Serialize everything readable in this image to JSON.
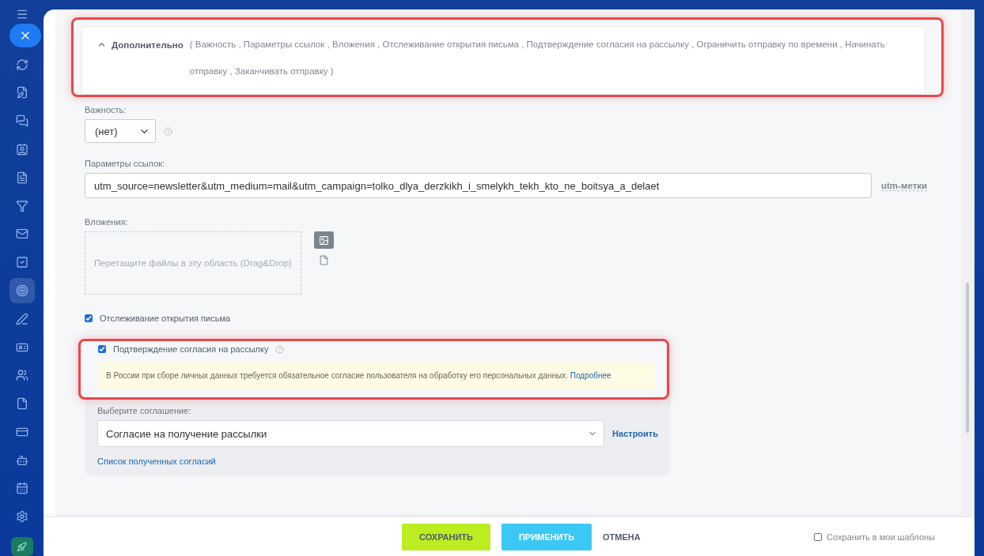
{
  "sidebar": {
    "items": [
      {
        "selected": false
      },
      {
        "selected": false
      },
      {
        "selected": false
      },
      {
        "selected": false
      },
      {
        "selected": false
      },
      {
        "selected": false
      },
      {
        "selected": false
      },
      {
        "selected": false
      },
      {
        "selected": true
      },
      {
        "selected": false
      },
      {
        "selected": false
      },
      {
        "selected": false
      },
      {
        "selected": false
      },
      {
        "selected": false
      },
      {
        "selected": false
      },
      {
        "selected": false
      }
    ]
  },
  "section": {
    "title": "Дополнительно",
    "expanded": true,
    "summary": "( Важность ,  Параметры ссылок ,  Вложения ,  Отслеживание открытия письма ,  Подтверждение согласия на рассылку ,  Ограничить отправку по времени ,  Начинать отправку ,  Заканчивать отправку  )"
  },
  "importance": {
    "label": "Важность:",
    "value": "(нет)"
  },
  "link_params": {
    "label": "Параметры ссылок:",
    "value": "utm_source=newsletter&utm_medium=mail&utm_campaign=tolko_dlya_derzkikh_i_smelykh_tekh_kto_ne_boitsya_a_delaet",
    "link": "utm-метки"
  },
  "attachments": {
    "label": "Вложения:",
    "dropzone": "Перетащите файлы в эту область (Drag&Drop)"
  },
  "tracking": {
    "label": "Отслеживание открытия письма",
    "checked": true
  },
  "consent": {
    "label": "Подтверждение согласия на рассылку",
    "checked": true,
    "note": "В России при сборе личных данных требуется обязательное согласие пользователя на обработку его персональных данных.",
    "note_link": "Подробнее",
    "agreement_label": "Выберите соглашение:",
    "agreement_value": "Согласие на получение рассылки",
    "configure": "Настроить",
    "list_link": "Список полученных согласий"
  },
  "footer": {
    "buttons": [
      {
        "label": "СОХРАНИТЬ",
        "kind": "save"
      },
      {
        "label": "ПРИМЕНИТЬ",
        "kind": "apply"
      },
      {
        "label": "ОТМЕНА",
        "kind": "cancel"
      }
    ],
    "template": {
      "label": "Сохранить в мои шаблоны",
      "checked": false
    }
  }
}
